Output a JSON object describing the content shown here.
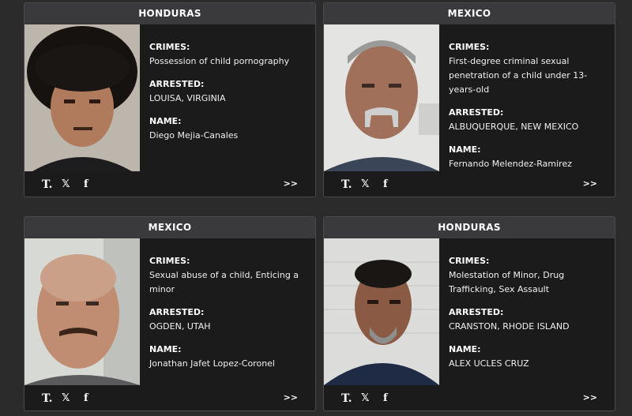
{
  "labels": {
    "crimes": "CRIMES:",
    "arrested": "ARRESTED:",
    "name": "NAME:",
    "more": ">>"
  },
  "icons": [
    "t-logo-icon",
    "x-icon",
    "facebook-icon"
  ],
  "cards": [
    {
      "country": "HONDURAS",
      "crimes": "Possession of child pornography",
      "arrested": "LOUISA, VIRGINIA",
      "name": "Diego Mejia-Canales"
    },
    {
      "country": "MEXICO",
      "crimes": "First-degree criminal sexual penetration of a child under 13-years-old",
      "arrested": "ALBUQUERQUE, NEW MEXICO",
      "name": "Fernando Melendez-Ramirez"
    },
    {
      "country": "MEXICO",
      "crimes": "Sexual abuse of a child, Enticing a minor",
      "arrested": "OGDEN, UTAH",
      "name": "Jonathan Jafet Lopez-Coronel"
    },
    {
      "country": "HONDURAS",
      "crimes": "Molestation of Minor, Drug Trafficking, Sex Assault",
      "arrested": "CRANSTON, RHODE ISLAND",
      "name": "ALEX UCLES CRUZ"
    }
  ]
}
